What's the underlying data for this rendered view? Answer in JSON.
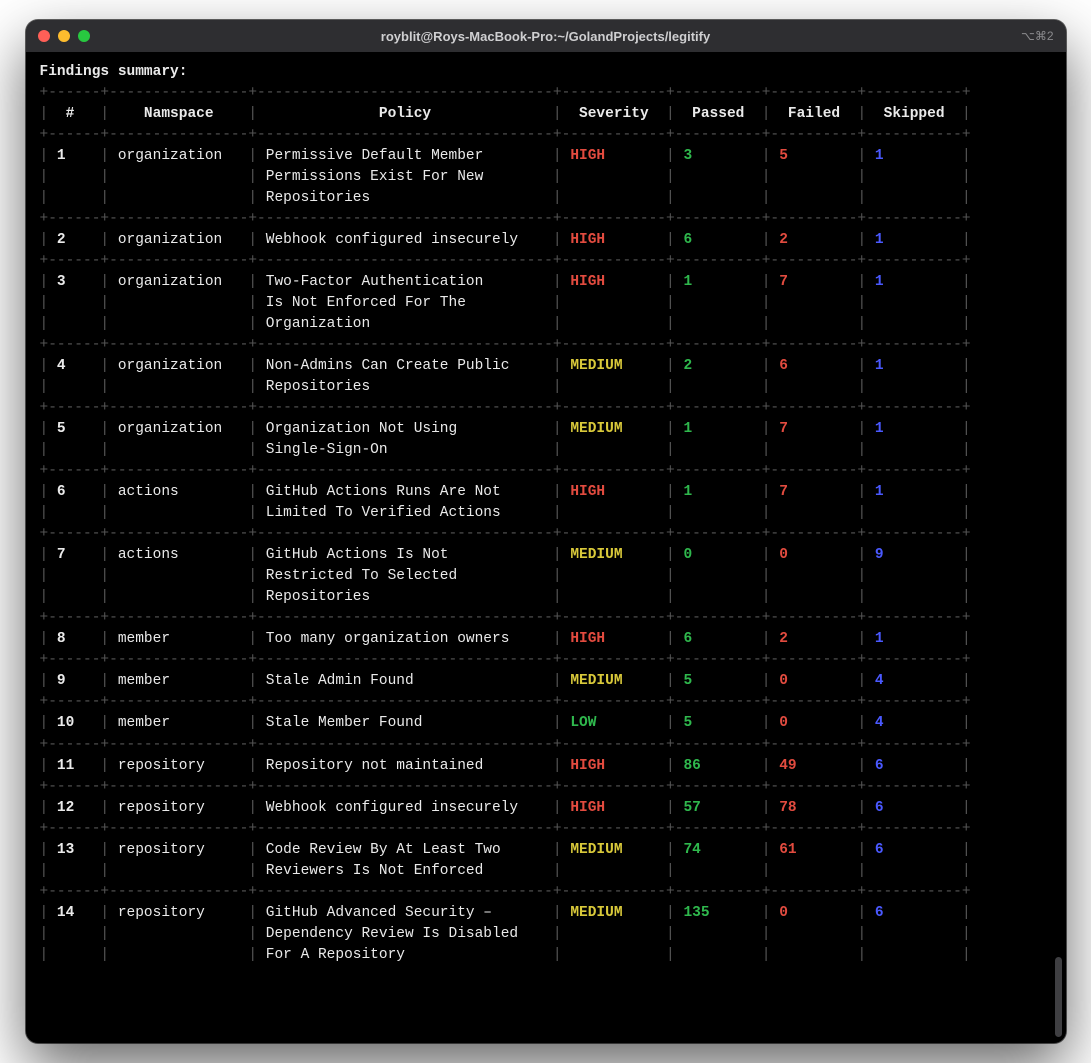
{
  "window": {
    "title": "royblit@Roys-MacBook-Pro:~/GolandProjects/legitify",
    "right_indicator": "⌥⌘2"
  },
  "terminal": {
    "heading": "Findings summary:",
    "columns": {
      "idx": "#",
      "namespace": "Namspace",
      "policy": "Policy",
      "severity": "Severity",
      "passed": "Passed",
      "failed": "Failed",
      "skipped": "Skipped"
    },
    "rows": [
      {
        "idx": "1",
        "namespace": "organization",
        "policy": [
          "Permissive Default Member",
          "Permissions Exist For New",
          "Repositories"
        ],
        "severity": "HIGH",
        "passed": "3",
        "failed": "5",
        "skipped": "1"
      },
      {
        "idx": "2",
        "namespace": "organization",
        "policy": [
          "Webhook configured insecurely"
        ],
        "severity": "HIGH",
        "passed": "6",
        "failed": "2",
        "skipped": "1"
      },
      {
        "idx": "3",
        "namespace": "organization",
        "policy": [
          "Two-Factor Authentication",
          "Is Not Enforced For The",
          "Organization"
        ],
        "severity": "HIGH",
        "passed": "1",
        "failed": "7",
        "skipped": "1"
      },
      {
        "idx": "4",
        "namespace": "organization",
        "policy": [
          "Non-Admins Can Create Public",
          "Repositories"
        ],
        "severity": "MEDIUM",
        "passed": "2",
        "failed": "6",
        "skipped": "1"
      },
      {
        "idx": "5",
        "namespace": "organization",
        "policy": [
          "Organization Not Using",
          "Single-Sign-On"
        ],
        "severity": "MEDIUM",
        "passed": "1",
        "failed": "7",
        "skipped": "1"
      },
      {
        "idx": "6",
        "namespace": "actions",
        "policy": [
          "GitHub Actions Runs Are Not",
          "Limited To Verified Actions"
        ],
        "severity": "HIGH",
        "passed": "1",
        "failed": "7",
        "skipped": "1"
      },
      {
        "idx": "7",
        "namespace": "actions",
        "policy": [
          "GitHub Actions Is Not",
          "Restricted To Selected",
          "Repositories"
        ],
        "severity": "MEDIUM",
        "passed": "0",
        "failed": "0",
        "skipped": "9"
      },
      {
        "idx": "8",
        "namespace": "member",
        "policy": [
          "Too many organization owners"
        ],
        "severity": "HIGH",
        "passed": "6",
        "failed": "2",
        "skipped": "1"
      },
      {
        "idx": "9",
        "namespace": "member",
        "policy": [
          "Stale Admin Found"
        ],
        "severity": "MEDIUM",
        "passed": "5",
        "failed": "0",
        "skipped": "4"
      },
      {
        "idx": "10",
        "namespace": "member",
        "policy": [
          "Stale Member Found"
        ],
        "severity": "LOW",
        "passed": "5",
        "failed": "0",
        "skipped": "4"
      },
      {
        "idx": "11",
        "namespace": "repository",
        "policy": [
          "Repository not maintained"
        ],
        "severity": "HIGH",
        "passed": "86",
        "failed": "49",
        "skipped": "6"
      },
      {
        "idx": "12",
        "namespace": "repository",
        "policy": [
          "Webhook configured insecurely"
        ],
        "severity": "HIGH",
        "passed": "57",
        "failed": "78",
        "skipped": "6"
      },
      {
        "idx": "13",
        "namespace": "repository",
        "policy": [
          "Code Review By At Least Two",
          "Reviewers Is Not Enforced"
        ],
        "severity": "MEDIUM",
        "passed": "74",
        "failed": "61",
        "skipped": "6"
      },
      {
        "idx": "14",
        "namespace": "repository",
        "policy": [
          "GitHub Advanced Security –",
          "Dependency Review Is Disabled",
          "For A Repository"
        ],
        "severity": "MEDIUM",
        "passed": "135",
        "failed": "0",
        "skipped": "6"
      }
    ],
    "colwidths": {
      "idx": 4,
      "namespace": 14,
      "policy": 32,
      "severity": 10,
      "passed": 8,
      "failed": 8,
      "skipped": 9
    },
    "colors": {
      "severity": {
        "HIGH": "red",
        "MEDIUM": "yellow",
        "LOW": "low"
      },
      "passed": "green",
      "failed": "red",
      "skipped": "blue"
    }
  }
}
